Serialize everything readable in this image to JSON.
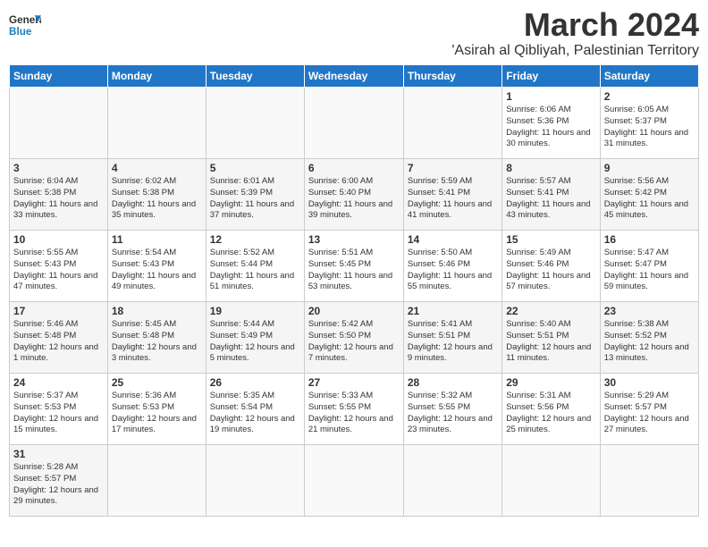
{
  "logo": {
    "text_general": "General",
    "text_blue": "Blue"
  },
  "title": "March 2024",
  "subtitle": "'Asirah al Qibliyah, Palestinian Territory",
  "days_of_week": [
    "Sunday",
    "Monday",
    "Tuesday",
    "Wednesday",
    "Thursday",
    "Friday",
    "Saturday"
  ],
  "weeks": [
    [
      {
        "day": "",
        "info": ""
      },
      {
        "day": "",
        "info": ""
      },
      {
        "day": "",
        "info": ""
      },
      {
        "day": "",
        "info": ""
      },
      {
        "day": "",
        "info": ""
      },
      {
        "day": "1",
        "info": "Sunrise: 6:06 AM\nSunset: 5:36 PM\nDaylight: 11 hours\nand 30 minutes."
      },
      {
        "day": "2",
        "info": "Sunrise: 6:05 AM\nSunset: 5:37 PM\nDaylight: 11 hours\nand 31 minutes."
      }
    ],
    [
      {
        "day": "3",
        "info": "Sunrise: 6:04 AM\nSunset: 5:38 PM\nDaylight: 11 hours\nand 33 minutes."
      },
      {
        "day": "4",
        "info": "Sunrise: 6:02 AM\nSunset: 5:38 PM\nDaylight: 11 hours\nand 35 minutes."
      },
      {
        "day": "5",
        "info": "Sunrise: 6:01 AM\nSunset: 5:39 PM\nDaylight: 11 hours\nand 37 minutes."
      },
      {
        "day": "6",
        "info": "Sunrise: 6:00 AM\nSunset: 5:40 PM\nDaylight: 11 hours\nand 39 minutes."
      },
      {
        "day": "7",
        "info": "Sunrise: 5:59 AM\nSunset: 5:41 PM\nDaylight: 11 hours\nand 41 minutes."
      },
      {
        "day": "8",
        "info": "Sunrise: 5:57 AM\nSunset: 5:41 PM\nDaylight: 11 hours\nand 43 minutes."
      },
      {
        "day": "9",
        "info": "Sunrise: 5:56 AM\nSunset: 5:42 PM\nDaylight: 11 hours\nand 45 minutes."
      }
    ],
    [
      {
        "day": "10",
        "info": "Sunrise: 5:55 AM\nSunset: 5:43 PM\nDaylight: 11 hours\nand 47 minutes."
      },
      {
        "day": "11",
        "info": "Sunrise: 5:54 AM\nSunset: 5:43 PM\nDaylight: 11 hours\nand 49 minutes."
      },
      {
        "day": "12",
        "info": "Sunrise: 5:52 AM\nSunset: 5:44 PM\nDaylight: 11 hours\nand 51 minutes."
      },
      {
        "day": "13",
        "info": "Sunrise: 5:51 AM\nSunset: 5:45 PM\nDaylight: 11 hours\nand 53 minutes."
      },
      {
        "day": "14",
        "info": "Sunrise: 5:50 AM\nSunset: 5:46 PM\nDaylight: 11 hours\nand 55 minutes."
      },
      {
        "day": "15",
        "info": "Sunrise: 5:49 AM\nSunset: 5:46 PM\nDaylight: 11 hours\nand 57 minutes."
      },
      {
        "day": "16",
        "info": "Sunrise: 5:47 AM\nSunset: 5:47 PM\nDaylight: 11 hours\nand 59 minutes."
      }
    ],
    [
      {
        "day": "17",
        "info": "Sunrise: 5:46 AM\nSunset: 5:48 PM\nDaylight: 12 hours\nand 1 minute."
      },
      {
        "day": "18",
        "info": "Sunrise: 5:45 AM\nSunset: 5:48 PM\nDaylight: 12 hours\nand 3 minutes."
      },
      {
        "day": "19",
        "info": "Sunrise: 5:44 AM\nSunset: 5:49 PM\nDaylight: 12 hours\nand 5 minutes."
      },
      {
        "day": "20",
        "info": "Sunrise: 5:42 AM\nSunset: 5:50 PM\nDaylight: 12 hours\nand 7 minutes."
      },
      {
        "day": "21",
        "info": "Sunrise: 5:41 AM\nSunset: 5:51 PM\nDaylight: 12 hours\nand 9 minutes."
      },
      {
        "day": "22",
        "info": "Sunrise: 5:40 AM\nSunset: 5:51 PM\nDaylight: 12 hours\nand 11 minutes."
      },
      {
        "day": "23",
        "info": "Sunrise: 5:38 AM\nSunset: 5:52 PM\nDaylight: 12 hours\nand 13 minutes."
      }
    ],
    [
      {
        "day": "24",
        "info": "Sunrise: 5:37 AM\nSunset: 5:53 PM\nDaylight: 12 hours\nand 15 minutes."
      },
      {
        "day": "25",
        "info": "Sunrise: 5:36 AM\nSunset: 5:53 PM\nDaylight: 12 hours\nand 17 minutes."
      },
      {
        "day": "26",
        "info": "Sunrise: 5:35 AM\nSunset: 5:54 PM\nDaylight: 12 hours\nand 19 minutes."
      },
      {
        "day": "27",
        "info": "Sunrise: 5:33 AM\nSunset: 5:55 PM\nDaylight: 12 hours\nand 21 minutes."
      },
      {
        "day": "28",
        "info": "Sunrise: 5:32 AM\nSunset: 5:55 PM\nDaylight: 12 hours\nand 23 minutes."
      },
      {
        "day": "29",
        "info": "Sunrise: 5:31 AM\nSunset: 5:56 PM\nDaylight: 12 hours\nand 25 minutes."
      },
      {
        "day": "30",
        "info": "Sunrise: 5:29 AM\nSunset: 5:57 PM\nDaylight: 12 hours\nand 27 minutes."
      }
    ],
    [
      {
        "day": "31",
        "info": "Sunrise: 5:28 AM\nSunset: 5:57 PM\nDaylight: 12 hours\nand 29 minutes."
      },
      {
        "day": "",
        "info": ""
      },
      {
        "day": "",
        "info": ""
      },
      {
        "day": "",
        "info": ""
      },
      {
        "day": "",
        "info": ""
      },
      {
        "day": "",
        "info": ""
      },
      {
        "day": "",
        "info": ""
      }
    ]
  ]
}
